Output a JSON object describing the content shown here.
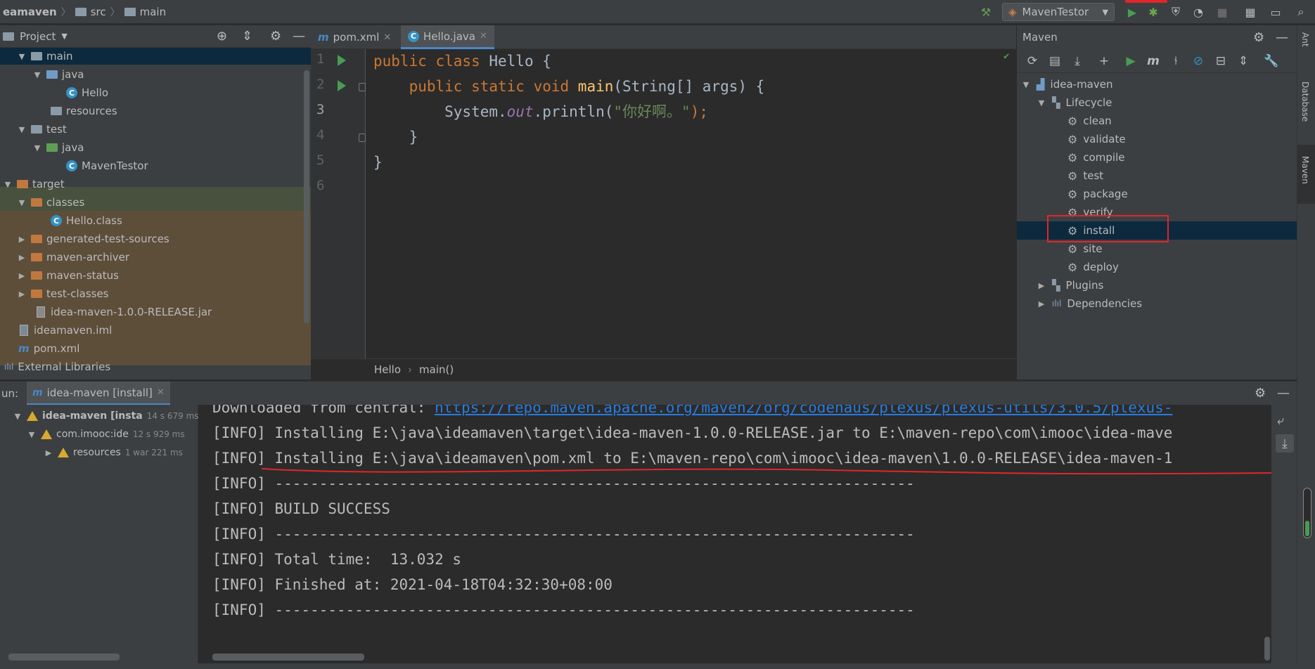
{
  "navbar": {
    "crumbs": [
      "eamaven",
      "src",
      "main"
    ],
    "run_config": "MavenTestor"
  },
  "project": {
    "title": "Project",
    "tree": [
      {
        "label": "main",
        "type": "folder-src"
      },
      {
        "label": "java",
        "type": "folder-blue"
      },
      {
        "label": "Hello",
        "type": "class"
      },
      {
        "label": "resources",
        "type": "folder"
      },
      {
        "label": "test",
        "type": "folder"
      },
      {
        "label": "java",
        "type": "folder-green"
      },
      {
        "label": "MavenTestor",
        "type": "class"
      },
      {
        "label": "target",
        "type": "folder-orange"
      },
      {
        "label": "classes",
        "type": "folder-orange"
      },
      {
        "label": "Hello.class",
        "type": "class"
      },
      {
        "label": "generated-test-sources",
        "type": "folder-orange"
      },
      {
        "label": "maven-archiver",
        "type": "folder-orange"
      },
      {
        "label": "maven-status",
        "type": "folder-orange"
      },
      {
        "label": "test-classes",
        "type": "folder-orange"
      },
      {
        "label": "idea-maven-1.0.0-RELEASE.jar",
        "type": "jar"
      },
      {
        "label": "ideamaven.iml",
        "type": "iml"
      },
      {
        "label": "pom.xml",
        "type": "maven"
      },
      {
        "label": "External Libraries",
        "type": "libs"
      }
    ]
  },
  "editor": {
    "tabs": [
      {
        "label": "pom.xml",
        "icon": "maven-icon"
      },
      {
        "label": "Hello.java",
        "icon": "class-icon"
      }
    ],
    "line_numbers": [
      "1",
      "2",
      "3",
      "4",
      "5",
      "6"
    ],
    "code": {
      "l1_kw": "public class ",
      "l1_rest": "Hello {",
      "l2_indent": "    ",
      "l2_kw": "public static void ",
      "l2_fn": "main",
      "l2_rest": "(String[] args) {",
      "l3_a": "        System.",
      "l3_fld": "out",
      "l3_b": ".println(",
      "l3_str": "\"你好啊。\"",
      "l3_c": ");",
      "l4": "    }",
      "l5": "}"
    },
    "breadcrumb": [
      "Hello",
      "main()"
    ]
  },
  "maven": {
    "title": "Maven",
    "root": "idea-maven",
    "lifecycle": "Lifecycle",
    "goals": [
      "clean",
      "validate",
      "compile",
      "test",
      "package",
      "verify",
      "install",
      "site",
      "deploy"
    ],
    "plugins": "Plugins",
    "dependencies": "Dependencies"
  },
  "right_strip": [
    "Ant",
    "Database",
    "Maven"
  ],
  "run": {
    "label": "un:",
    "tab": "idea-maven [install]",
    "tree": [
      {
        "label": "idea-maven [insta",
        "time": "14 s 679 ms"
      },
      {
        "label": "com.imooc:ide",
        "time": "12 s 929 ms"
      },
      {
        "label": "resources",
        "time": "1 war 221 ms"
      }
    ],
    "console": {
      "l0_prefix": "Downloaded from central: ",
      "l0_link": "https://repo.maven.apache.org/maven2/org/codehaus/plexus/plexus-utils/3.0.5/plexus-",
      "l1": "[INFO] Installing E:\\java\\ideamaven\\target\\idea-maven-1.0.0-RELEASE.jar to E:\\maven-repo\\com\\imooc\\idea-mave",
      "l2": "[INFO] Installing E:\\java\\ideamaven\\pom.xml to E:\\maven-repo\\com\\imooc\\idea-maven\\1.0.0-RELEASE\\idea-maven-1",
      "l3": "[INFO] ------------------------------------------------------------------------",
      "l4": "[INFO] BUILD SUCCESS",
      "l5": "[INFO] ------------------------------------------------------------------------",
      "l6": "[INFO] Total time:  13.032 s",
      "l7": "[INFO] Finished at: 2021-04-18T04:32:30+08:00",
      "l8": "[INFO] ------------------------------------------------------------------------"
    }
  },
  "colors": {
    "accent": "#4a88c7",
    "annotation": "#e0262b",
    "run_green": "#499c54"
  }
}
